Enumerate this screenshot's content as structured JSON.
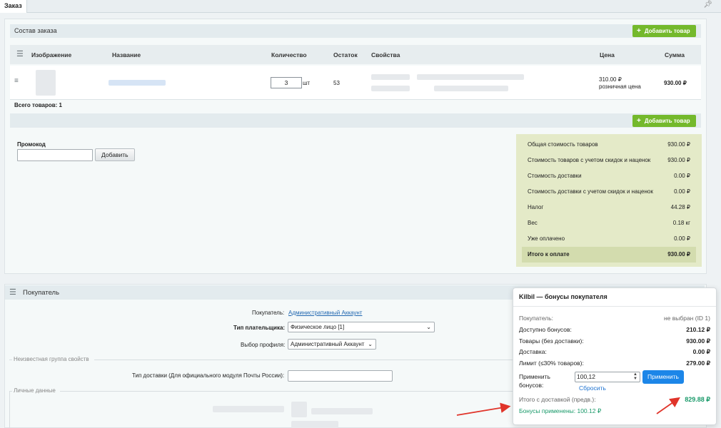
{
  "tab": {
    "label": "Заказ"
  },
  "order": {
    "section_title": "Состав заказа",
    "add_button": "Добавить товар",
    "columns": [
      "Изображение",
      "Название",
      "Количество",
      "Остаток",
      "Свойства",
      "Цена",
      "Сумма"
    ],
    "item": {
      "quantity": "3",
      "unit": "шт",
      "stock": "53",
      "price": "310.00 ₽",
      "price_type": "розничная цена",
      "sum": "930.00 ₽"
    },
    "total_items": "Всего товаров: 1"
  },
  "promo": {
    "label": "Промокод",
    "button": "Добавить"
  },
  "summary": {
    "rows": [
      {
        "label": "Общая стоимость товаров",
        "value": "930.00 ₽"
      },
      {
        "label": "Стоимость товаров с учетом скидок и наценок",
        "value": "930.00 ₽"
      },
      {
        "label": "Стоимость доставки",
        "value": "0.00 ₽"
      },
      {
        "label": "Стоимость доставки с учетом скидок и наценок",
        "value": "0.00 ₽"
      },
      {
        "label": "Налог",
        "value": "44.28 ₽"
      },
      {
        "label": "Вес",
        "value": "0.18 кг"
      },
      {
        "label": "Уже оплачено",
        "value": "0.00 ₽"
      }
    ],
    "total_label": "Итого к оплате",
    "total_value": "930.00 ₽"
  },
  "buyer": {
    "section_title": "Покупатель",
    "buyer_label": "Покупатель:",
    "buyer_link": "Административный Аккаунт",
    "payer_type_label": "Тип плательщика:",
    "payer_type_value": "Физическое лицо [1]",
    "profile_label": "Выбор профиля:",
    "profile_value": "Административный Аккаунт",
    "group_unknown": "Неизвестная группа свойств",
    "delivery_type_label": "Тип доставки (Для официального модуля Почты России):",
    "group_personal": "Личные данные"
  },
  "bonus_panel": {
    "title": "Kilbil — бонусы покупателя",
    "customer_label": "Покупатель:",
    "customer_value": "не выбран (ID 1)",
    "available_label": "Доступно бонусов:",
    "available_value": "210.12 ₽",
    "goods_label": "Товары (без доставки):",
    "goods_value": "930.00 ₽",
    "delivery_label": "Доставка:",
    "delivery_value": "0.00 ₽",
    "limit_label": "Лимит (≤30% товаров):",
    "limit_value": "279.00 ₽",
    "apply_label": "Применить бонусов:",
    "apply_input": "100,12",
    "apply_button": "Применить",
    "reset_link": "Сбросить",
    "total_label": "Итого с доставкой (предв.):",
    "total_value": "829.88 ₽",
    "applied_text": "Бонусы применены: 100.12 ₽"
  },
  "colors": {
    "green_button": "#74b92c",
    "blue_button": "#1c86e8",
    "bonus_green": "#1a9a6a",
    "arrow_red": "#e0342a"
  }
}
